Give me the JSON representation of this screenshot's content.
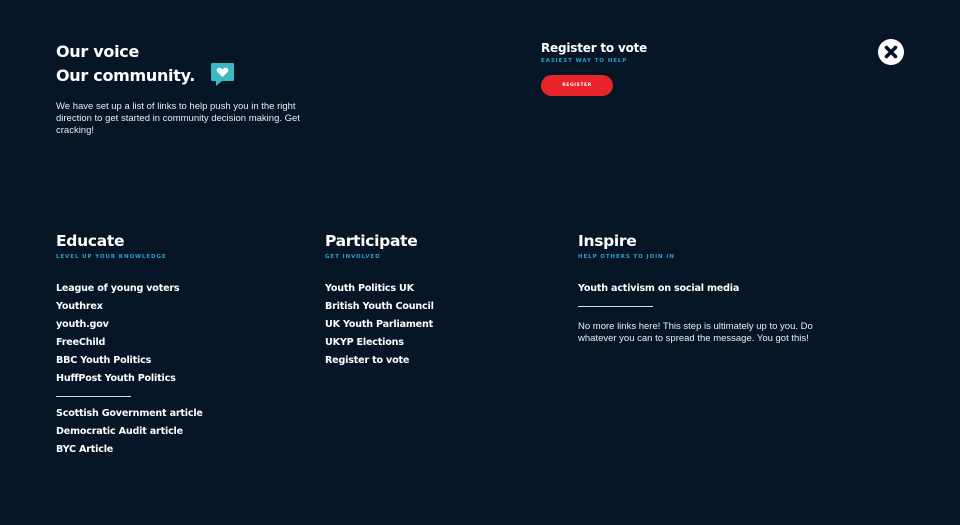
{
  "intro": {
    "title_line1": "Our voice",
    "title_line2": "Our community.",
    "description": "We have set up a list of links to help push you in the right direction to get started in community decision making. Get cracking!"
  },
  "register": {
    "title": "Register to vote",
    "subtitle": "EASIEST WAY TO HELP",
    "button_label": "REGISTER"
  },
  "colors": {
    "background": "#061626",
    "accent_teal": "#2aa0c6",
    "button_red": "#e8232a",
    "icon_teal": "#3bb8c4"
  },
  "icons": {
    "chat": "chat-heart-icon",
    "close": "close-icon"
  },
  "columns": {
    "educate": {
      "title": "Educate",
      "subtitle": "LEVEL UP YOUR KNOWLEDGE",
      "links": [
        "League of young voters",
        "Youthrex",
        "youth.gov",
        "FreeChild",
        "BBC Youth Politics",
        "HuffPost Youth Politics"
      ],
      "links_secondary": [
        "Scottish Government article",
        "Democratic Audit article",
        "BYC Article"
      ]
    },
    "participate": {
      "title": "Participate",
      "subtitle": "GET INVOLVED",
      "links": [
        "Youth Politics UK",
        "British Youth Council",
        "UK Youth Parliament",
        "UKYP Elections",
        "Register to vote"
      ]
    },
    "inspire": {
      "title": "Inspire",
      "subtitle": "HELP OTHERS TO JOIN IN",
      "links": [
        "Youth activism on social media"
      ],
      "description": "No more links here! This step is ultimately up to you. Do whatever you can to spread the message. You got this!"
    }
  }
}
